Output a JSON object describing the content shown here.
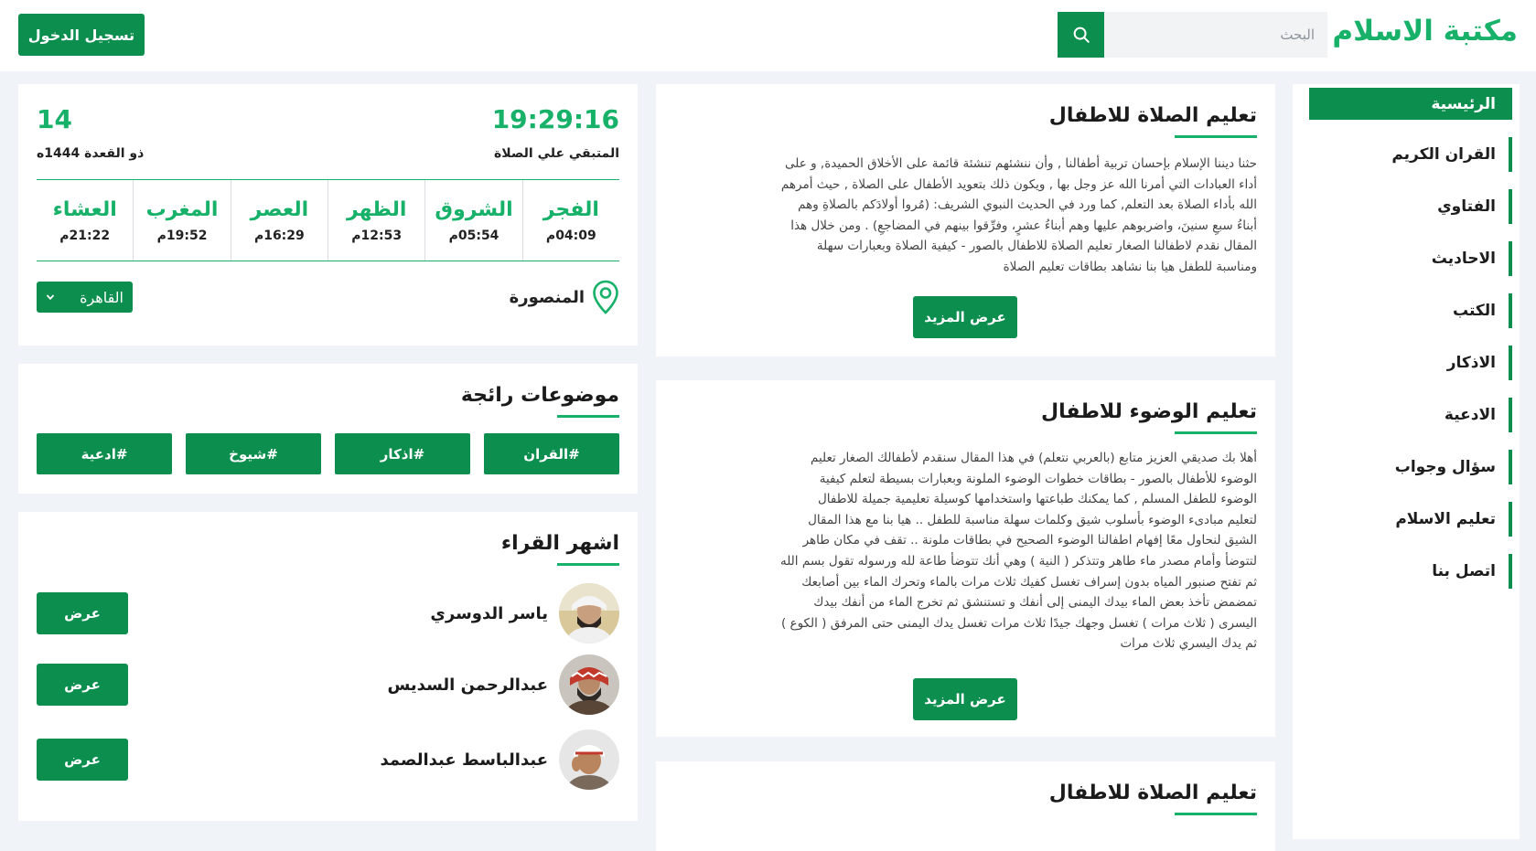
{
  "header": {
    "logo": "مكتبة الاسلام",
    "search_placeholder": "البحث",
    "login_label": "تسجيل الدخول"
  },
  "sidebar": {
    "items": [
      {
        "label": "الرئيسية",
        "active": true
      },
      {
        "label": "القران الكريم"
      },
      {
        "label": "الفتاوي"
      },
      {
        "label": "الاحاديث"
      },
      {
        "label": "الكتب"
      },
      {
        "label": "الاذكار"
      },
      {
        "label": "الادعية"
      },
      {
        "label": "سؤال وجواب"
      },
      {
        "label": "تعليم الاسلام"
      },
      {
        "label": "اتصل بنا"
      }
    ]
  },
  "articles": [
    {
      "title": "تعليم الصلاة للاطفال",
      "lines": [
        "حثنا ديننا الإسلام بإحسان تربية أطفالنا , وأن ننشئهم تنشئة قائمة على الأخلاق الحميدة, و على",
        "أداء العبادات التي أمرنا الله عز وجل بها , ويكون ذلك بتعويد الأطفال على الصلاة , حيث أمرهم",
        "الله بأداء الصلاة بعد التعلم, كما ورد في الحديث النبوي الشريف: (مُروا أولادَكم بالصلاةِ وهم",
        "أبناءُ سبعِ سنينَ، واضربوهم عليها وهم أبناءُ عشرٍ، وفرِّقوا بينهم في المضاجعِ) . ومن خلال هذا",
        "المقال نقدم لاطفالنا الصغار تعليم الصلاة للاطفال بالصور - كيفية الصلاة وبعبارات سهلة",
        "ومناسبة للطفل هيا بنا نشاهد بطاقات تعليم الصلاة"
      ],
      "more_label": "عرض المزيد"
    },
    {
      "title": "تعليم الوضوء للاطفال",
      "lines": [
        "أهلا بك صديقي العزيز متابع (بالعربي نتعلم) في هذا المقال سنقدم لأطفالك الصغار تعليم",
        "الوضوء للأطفال بالصور - بطاقات خطوات الوضوء الملونة وبعبارات بسيطة لتعلم كيفية",
        "الوضوء للطفل المسلم , كما يمكنك طباعتها واستخدامها كوسيلة تعليمية جميلة للاطفال",
        "لتعليم مبادىء الوضوء بأسلوب شيق وكلمات سهلة مناسبة للطفل .. هيا بنا مع هذا المقال",
        "الشيق لنحاول معًا إفهام اطفالنا الوضوء الصحيح في بطاقات ملونة .. تقف في مكان طاهر",
        "لتتوضأ وأمام مصدر ماء طاهر وتتذكر ( النية ) وهي أنك تتوضأ طاعة لله ورسوله تقول بسم الله",
        "ثم تفتح صنبور المياه بدون إسراف تغسل كفيك ثلاث مرات بالماء وتحرك الماء بين أصابعك",
        "تمضمض تأخذ بعض الماء بيدك اليمنى إلى أنفك و تستنشق ثم تخرج الماء من أنفك بيدك",
        "اليسرى ( ثلاث مرات ) تغسل وجهك جيدًا ثلاث مرات تغسل يدك اليمنى حتى المرفق ( الكوع )",
        "ثم يدك اليسري ثلاث مرات"
      ],
      "more_label": "عرض المزيد"
    },
    {
      "title": "تعليم الصلاة للاطفال"
    }
  ],
  "prayer": {
    "clock": "19:29:16",
    "remaining_label": "المتبقي علي الصلاة",
    "day": "14",
    "hijri": "ذو القعدة 1444ه",
    "times": [
      {
        "name": "الفجر",
        "time": "04:09م"
      },
      {
        "name": "الشروق",
        "time": "05:54م"
      },
      {
        "name": "الظهر",
        "time": "12:53م"
      },
      {
        "name": "العصر",
        "time": "16:29م"
      },
      {
        "name": "المغرب",
        "time": "19:52م"
      },
      {
        "name": "العشاء",
        "time": "21:22م"
      }
    ],
    "location": "المنصورة",
    "city_selected": "القاهرة"
  },
  "trending": {
    "title": "موضوعات رائجة",
    "tags": [
      "#القران",
      "#اذكار",
      "#شيوخ",
      "#ادعية"
    ]
  },
  "reciters": {
    "title": "اشهر القراء",
    "items": [
      {
        "name": "ياسر الدوسري",
        "view_label": "عرض"
      },
      {
        "name": "عبدالرحمن السديس",
        "view_label": "عرض"
      },
      {
        "name": "عبدالباسط عبدالصمد",
        "view_label": "عرض"
      }
    ]
  },
  "colors": {
    "primary": "#0b8e4e",
    "accent": "#17b169",
    "background": "#f0f3f7"
  }
}
